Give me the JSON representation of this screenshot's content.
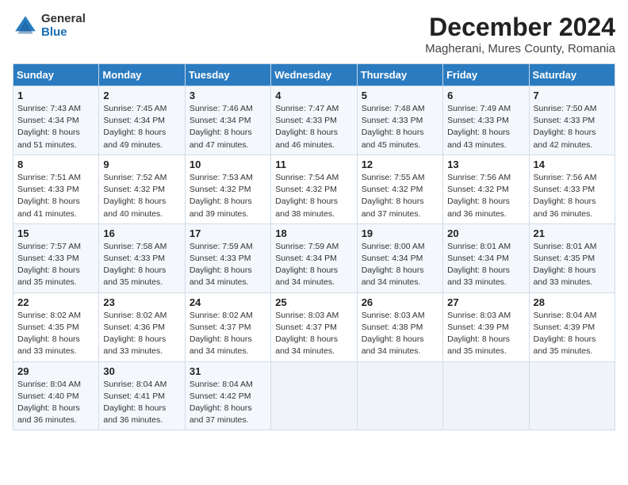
{
  "logo": {
    "general": "General",
    "blue": "Blue"
  },
  "title": "December 2024",
  "subtitle": "Magherani, Mures County, Romania",
  "weekdays": [
    "Sunday",
    "Monday",
    "Tuesday",
    "Wednesday",
    "Thursday",
    "Friday",
    "Saturday"
  ],
  "weeks": [
    [
      {
        "day": 1,
        "sunrise": "7:43 AM",
        "sunset": "4:34 PM",
        "daylight": "8 hours and 51 minutes."
      },
      {
        "day": 2,
        "sunrise": "7:45 AM",
        "sunset": "4:34 PM",
        "daylight": "8 hours and 49 minutes."
      },
      {
        "day": 3,
        "sunrise": "7:46 AM",
        "sunset": "4:34 PM",
        "daylight": "8 hours and 47 minutes."
      },
      {
        "day": 4,
        "sunrise": "7:47 AM",
        "sunset": "4:33 PM",
        "daylight": "8 hours and 46 minutes."
      },
      {
        "day": 5,
        "sunrise": "7:48 AM",
        "sunset": "4:33 PM",
        "daylight": "8 hours and 45 minutes."
      },
      {
        "day": 6,
        "sunrise": "7:49 AM",
        "sunset": "4:33 PM",
        "daylight": "8 hours and 43 minutes."
      },
      {
        "day": 7,
        "sunrise": "7:50 AM",
        "sunset": "4:33 PM",
        "daylight": "8 hours and 42 minutes."
      }
    ],
    [
      {
        "day": 8,
        "sunrise": "7:51 AM",
        "sunset": "4:33 PM",
        "daylight": "8 hours and 41 minutes."
      },
      {
        "day": 9,
        "sunrise": "7:52 AM",
        "sunset": "4:32 PM",
        "daylight": "8 hours and 40 minutes."
      },
      {
        "day": 10,
        "sunrise": "7:53 AM",
        "sunset": "4:32 PM",
        "daylight": "8 hours and 39 minutes."
      },
      {
        "day": 11,
        "sunrise": "7:54 AM",
        "sunset": "4:32 PM",
        "daylight": "8 hours and 38 minutes."
      },
      {
        "day": 12,
        "sunrise": "7:55 AM",
        "sunset": "4:32 PM",
        "daylight": "8 hours and 37 minutes."
      },
      {
        "day": 13,
        "sunrise": "7:56 AM",
        "sunset": "4:32 PM",
        "daylight": "8 hours and 36 minutes."
      },
      {
        "day": 14,
        "sunrise": "7:56 AM",
        "sunset": "4:33 PM",
        "daylight": "8 hours and 36 minutes."
      }
    ],
    [
      {
        "day": 15,
        "sunrise": "7:57 AM",
        "sunset": "4:33 PM",
        "daylight": "8 hours and 35 minutes."
      },
      {
        "day": 16,
        "sunrise": "7:58 AM",
        "sunset": "4:33 PM",
        "daylight": "8 hours and 35 minutes."
      },
      {
        "day": 17,
        "sunrise": "7:59 AM",
        "sunset": "4:33 PM",
        "daylight": "8 hours and 34 minutes."
      },
      {
        "day": 18,
        "sunrise": "7:59 AM",
        "sunset": "4:34 PM",
        "daylight": "8 hours and 34 minutes."
      },
      {
        "day": 19,
        "sunrise": "8:00 AM",
        "sunset": "4:34 PM",
        "daylight": "8 hours and 34 minutes."
      },
      {
        "day": 20,
        "sunrise": "8:01 AM",
        "sunset": "4:34 PM",
        "daylight": "8 hours and 33 minutes."
      },
      {
        "day": 21,
        "sunrise": "8:01 AM",
        "sunset": "4:35 PM",
        "daylight": "8 hours and 33 minutes."
      }
    ],
    [
      {
        "day": 22,
        "sunrise": "8:02 AM",
        "sunset": "4:35 PM",
        "daylight": "8 hours and 33 minutes."
      },
      {
        "day": 23,
        "sunrise": "8:02 AM",
        "sunset": "4:36 PM",
        "daylight": "8 hours and 33 minutes."
      },
      {
        "day": 24,
        "sunrise": "8:02 AM",
        "sunset": "4:37 PM",
        "daylight": "8 hours and 34 minutes."
      },
      {
        "day": 25,
        "sunrise": "8:03 AM",
        "sunset": "4:37 PM",
        "daylight": "8 hours and 34 minutes."
      },
      {
        "day": 26,
        "sunrise": "8:03 AM",
        "sunset": "4:38 PM",
        "daylight": "8 hours and 34 minutes."
      },
      {
        "day": 27,
        "sunrise": "8:03 AM",
        "sunset": "4:39 PM",
        "daylight": "8 hours and 35 minutes."
      },
      {
        "day": 28,
        "sunrise": "8:04 AM",
        "sunset": "4:39 PM",
        "daylight": "8 hours and 35 minutes."
      }
    ],
    [
      {
        "day": 29,
        "sunrise": "8:04 AM",
        "sunset": "4:40 PM",
        "daylight": "8 hours and 36 minutes."
      },
      {
        "day": 30,
        "sunrise": "8:04 AM",
        "sunset": "4:41 PM",
        "daylight": "8 hours and 36 minutes."
      },
      {
        "day": 31,
        "sunrise": "8:04 AM",
        "sunset": "4:42 PM",
        "daylight": "8 hours and 37 minutes."
      },
      null,
      null,
      null,
      null
    ]
  ]
}
